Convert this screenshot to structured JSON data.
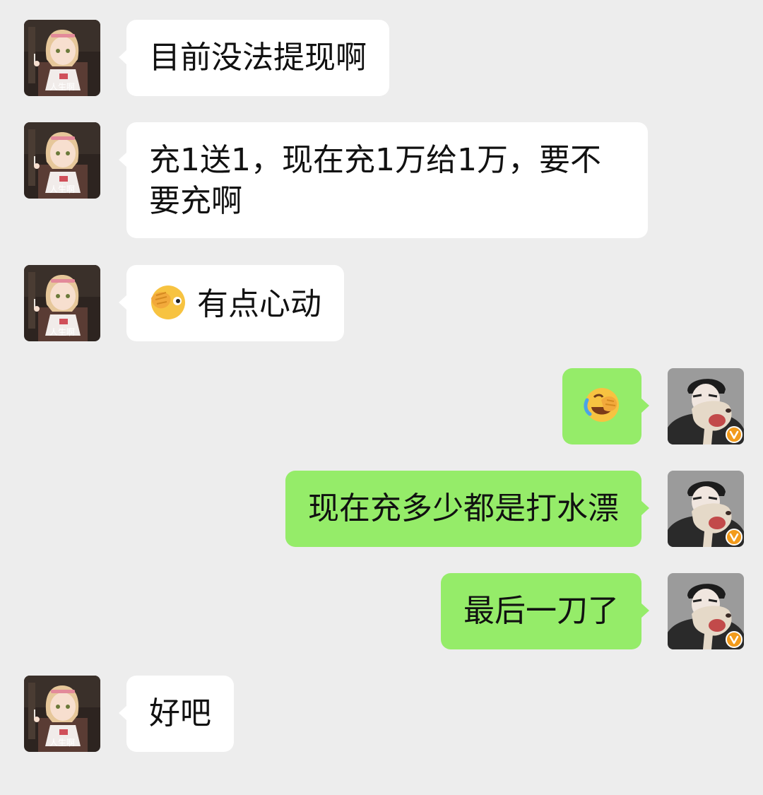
{
  "theme": {
    "background": "#ededed",
    "incoming_bubble": "#ffffff",
    "outgoing_bubble": "#95ec69",
    "text": "#111111"
  },
  "contact": {
    "avatar_caption": "人生啊",
    "avatar_icon": "anime-girl-avatar-icon"
  },
  "me": {
    "avatar_icon": "man-with-dog-avatar-icon",
    "badge_icon": "v-badge-icon"
  },
  "messages": [
    {
      "sender": "contact",
      "text": "目前没法提现啊"
    },
    {
      "sender": "contact",
      "text": "充1送1，现在充1万给1万，要不要充啊"
    },
    {
      "sender": "contact",
      "emoji": "facepalm-peek-emoji-icon",
      "text": "有点心动"
    },
    {
      "sender": "me",
      "emoji": "laughing-crying-emoji-icon",
      "text": ""
    },
    {
      "sender": "me",
      "text": "现在充多少都是打水漂"
    },
    {
      "sender": "me",
      "text": "最后一刀了"
    },
    {
      "sender": "contact",
      "text": "好吧"
    }
  ]
}
